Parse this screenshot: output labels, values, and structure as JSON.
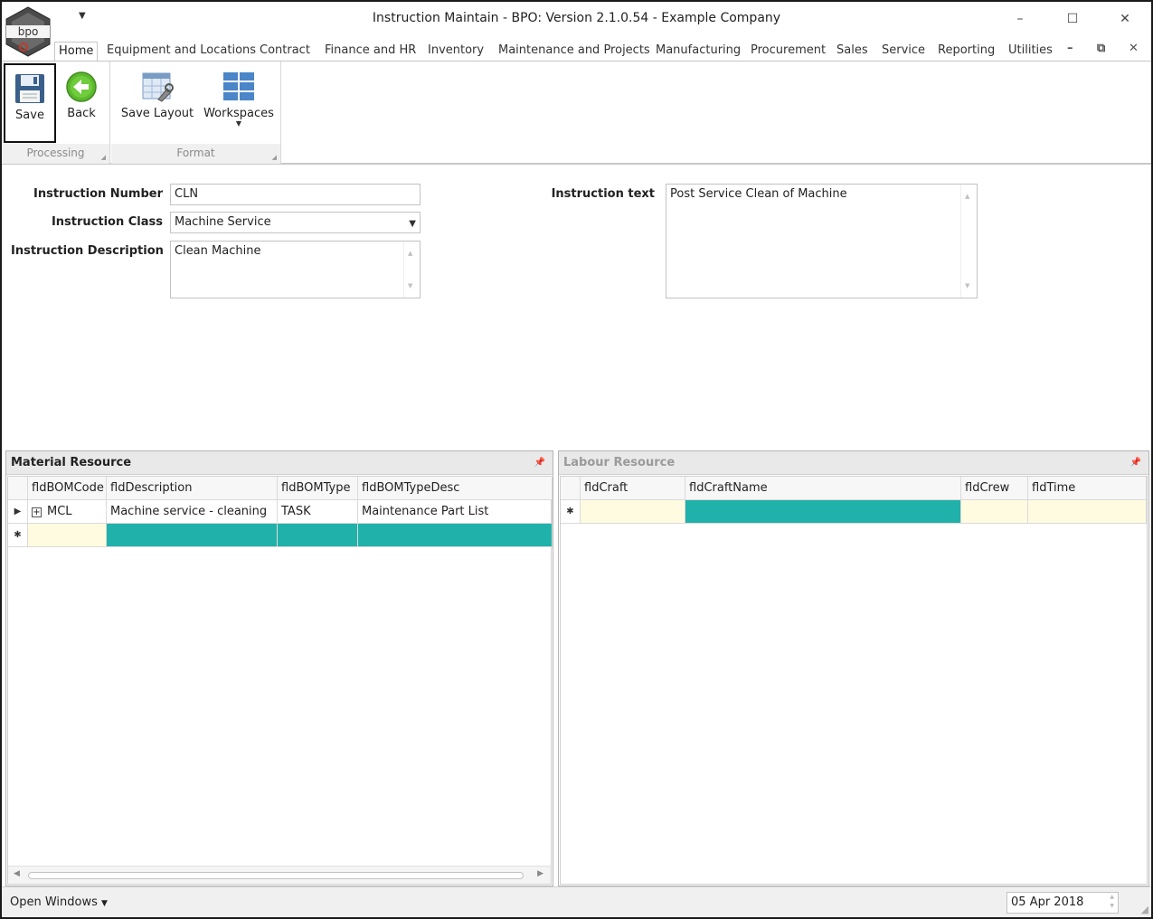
{
  "window": {
    "title": "Instruction Maintain - BPO: Version 2.1.0.54 - Example Company",
    "logo_text": "bpo",
    "minimize": "–",
    "maximize": "☐",
    "close": "✕"
  },
  "ribbon": {
    "tabs": [
      {
        "label": "Home",
        "active": true
      },
      {
        "label": "Equipment and Locations"
      },
      {
        "label": "Contract"
      },
      {
        "label": "Finance and HR"
      },
      {
        "label": "Inventory"
      },
      {
        "label": "Maintenance and Projects"
      },
      {
        "label": "Manufacturing"
      },
      {
        "label": "Procurement"
      },
      {
        "label": "Sales"
      },
      {
        "label": "Service"
      },
      {
        "label": "Reporting"
      },
      {
        "label": "Utilities"
      }
    ],
    "groups": {
      "processing": {
        "label": "Processing",
        "save": "Save",
        "back": "Back"
      },
      "format": {
        "label": "Format",
        "save_layout": "Save Layout",
        "workspaces": "Workspaces"
      }
    },
    "colors": {
      "back_green": "#5cb82e",
      "save_blue": "#3a5f8a"
    }
  },
  "form": {
    "instruction_number": {
      "label": "Instruction Number",
      "value": "CLN"
    },
    "instruction_class": {
      "label": "Instruction Class",
      "value": "Machine Service"
    },
    "instruction_description": {
      "label": "Instruction Description",
      "value": "Clean Machine"
    },
    "instruction_text": {
      "label": "Instruction text",
      "value": "Post Service Clean of Machine"
    }
  },
  "material": {
    "title": "Material Resource",
    "columns": [
      "fldBOMCode",
      "fldDescription",
      "fldBOMType",
      "fldBOMTypeDesc"
    ],
    "rows": [
      {
        "code": "MCL",
        "description": "Machine service - cleaning",
        "type": "TASK",
        "type_desc": "Maintenance Part List"
      }
    ]
  },
  "labour": {
    "title": "Labour Resource",
    "columns": [
      "fldCraft",
      "fldCraftName",
      "fldCrew",
      "fldTime"
    ]
  },
  "status": {
    "open_windows": "Open Windows",
    "date": "05 Apr 2018"
  },
  "accent_color": "#20b2aa"
}
